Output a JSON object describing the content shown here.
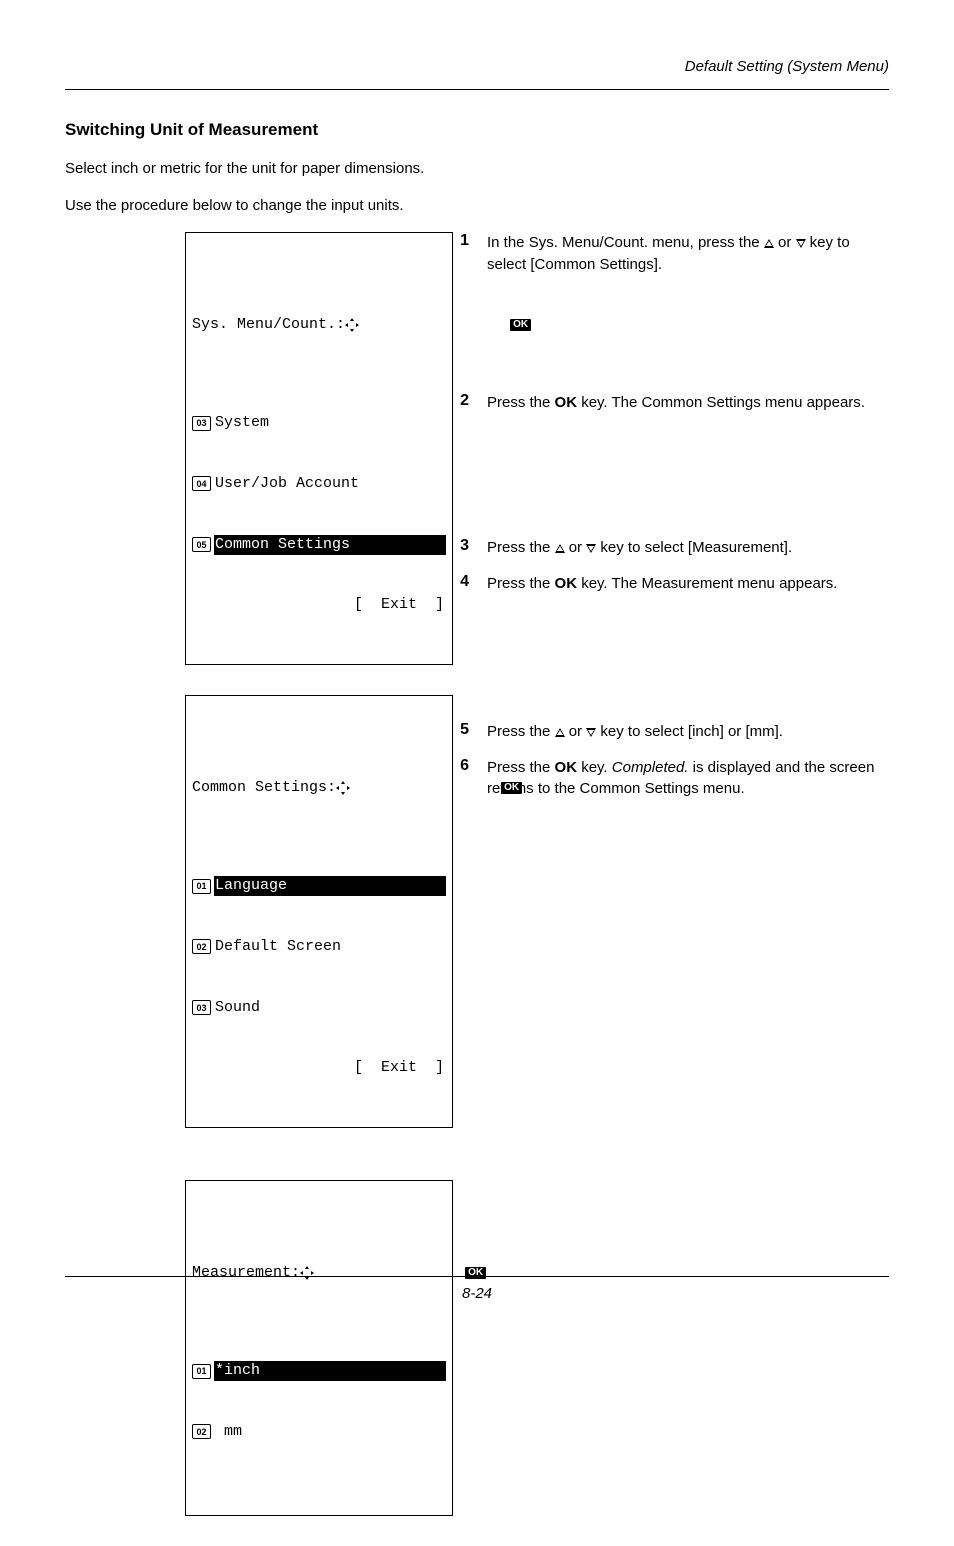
{
  "header": {
    "section_title": "Default Setting (System Menu)"
  },
  "headings": {
    "h2": "Switching Unit of Measurement"
  },
  "intro": {
    "p1": "Select inch or metric for the unit for paper dimensions.",
    "p2": "Use the procedure below to change the input units."
  },
  "lcd1": {
    "title": "Sys. Menu/Count.:",
    "ok": "OK",
    "rows": [
      {
        "num": "03",
        "text": "System",
        "selected": false
      },
      {
        "num": "04",
        "text": "User/Job Account",
        "selected": false
      },
      {
        "num": "05",
        "text": "Common Settings",
        "selected": true
      }
    ],
    "softkey": "[  Exit  ]"
  },
  "lcd2": {
    "title": "Common Settings:",
    "ok": "OK",
    "rows": [
      {
        "num": "01",
        "text": "Language",
        "selected": true
      },
      {
        "num": "02",
        "text": "Default Screen",
        "selected": false
      },
      {
        "num": "03",
        "text": "Sound",
        "selected": false
      }
    ],
    "softkey": "[  Exit  ]"
  },
  "lcd3": {
    "title": "Measurement:",
    "ok": "OK",
    "rows": [
      {
        "num": "01",
        "text": "*inch",
        "selected": true
      },
      {
        "num": "02",
        "text": " mm",
        "selected": false
      }
    ]
  },
  "steps": {
    "s1": {
      "num": "1",
      "pre": "In the Sys. Menu/Count. menu, press the ",
      "mid": " or ",
      "post": " key to select [Common Settings]."
    },
    "s2": {
      "num": "2",
      "pre": "Press the ",
      "ok": "OK",
      "post": " key. The Common Settings menu appears."
    },
    "s3": {
      "num": "3",
      "pre": "Press the ",
      "mid": " or ",
      "post": " key to select [Measurement]."
    },
    "s4": {
      "num": "4",
      "pre": "Press the ",
      "ok": "OK",
      "post": " key. The Measurement menu appears."
    },
    "s5": {
      "num": "5",
      "pre": "Press the ",
      "mid": " or ",
      "post": " key to select [inch] or [mm]."
    },
    "s6": {
      "num": "6",
      "pre": "Press the ",
      "ok": "OK",
      "post_a": " key. ",
      "completed": "Completed.",
      "post_b": " is displayed and the screen returns to the Common Settings menu."
    }
  },
  "footer": {
    "folio": "8-24"
  }
}
